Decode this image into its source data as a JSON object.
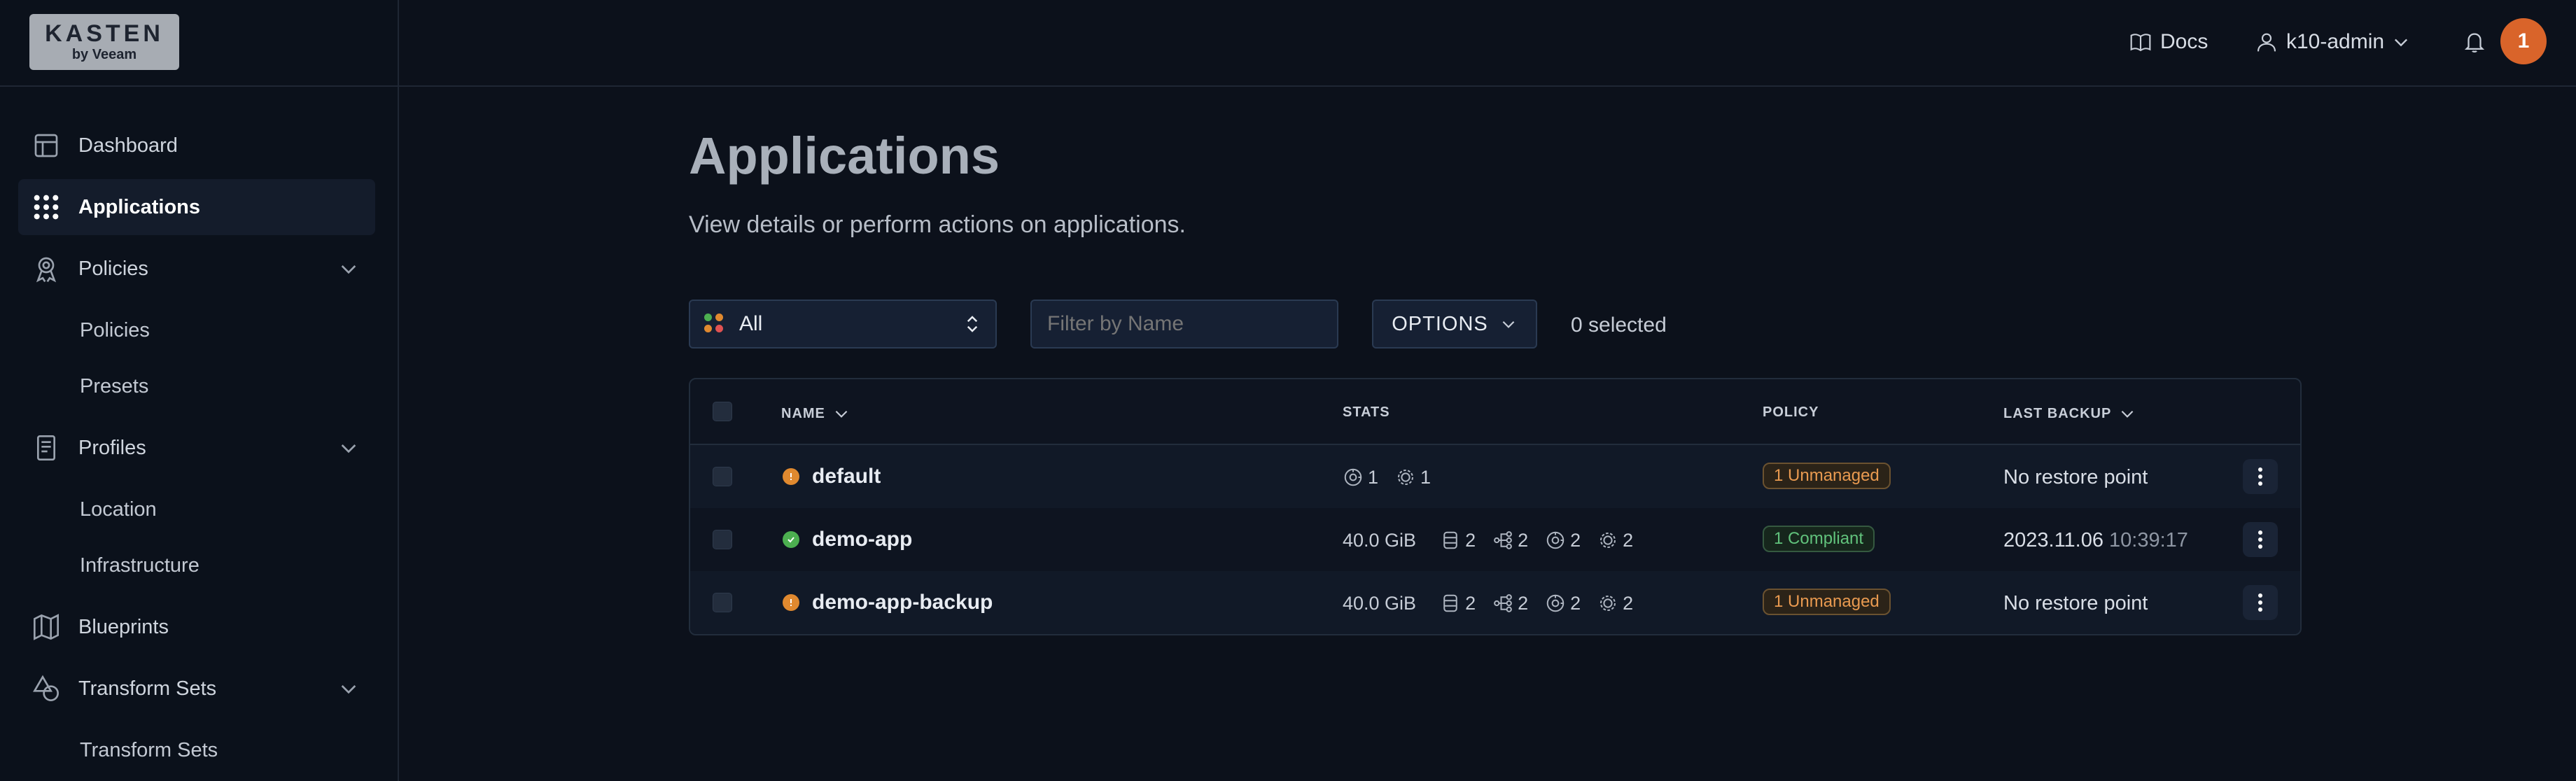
{
  "brand": {
    "logo_line1": "KASTEN",
    "logo_line2": "by Veeam"
  },
  "header": {
    "docs_label": "Docs",
    "user_label": "k10-admin",
    "notification_count": "1"
  },
  "sidebar": {
    "items": [
      {
        "label": "Dashboard",
        "icon": "layout-icon"
      },
      {
        "label": "Applications",
        "icon": "grid-dots-icon",
        "active": true
      },
      {
        "label": "Policies",
        "icon": "award-icon",
        "children": [
          "Policies",
          "Presets"
        ]
      },
      {
        "label": "Profiles",
        "icon": "document-icon",
        "children": [
          "Location",
          "Infrastructure"
        ]
      },
      {
        "label": "Blueprints",
        "icon": "map-icon"
      },
      {
        "label": "Transform Sets",
        "icon": "shapes-icon",
        "children": [
          "Transform Sets"
        ]
      }
    ]
  },
  "main": {
    "title": "Applications",
    "subtitle": "View details or perform actions on applications.",
    "filter": {
      "selected": "All",
      "name_placeholder": "Filter by Name",
      "options_label": "OPTIONS",
      "selected_count": "0 selected"
    },
    "table": {
      "columns": {
        "name": "NAME",
        "stats": "STATS",
        "policy": "POLICY",
        "last_backup": "LAST BACKUP"
      },
      "rows": [
        {
          "name": "default",
          "status": "warning",
          "size": "",
          "volumes": "",
          "workloads": "",
          "restore_points": "1",
          "policies": "1",
          "policy": "1 Unmanaged",
          "last_backup": "No restore point",
          "last_backup_time": ""
        },
        {
          "name": "demo-app",
          "status": "ok",
          "size": "40.0 GiB",
          "volumes": "2",
          "workloads": "2",
          "restore_points": "2",
          "policies": "2",
          "policy": "1 Compliant",
          "last_backup": "2023.11.06",
          "last_backup_time": "10:39:17"
        },
        {
          "name": "demo-app-backup",
          "status": "warning",
          "size": "40.0 GiB",
          "volumes": "2",
          "workloads": "2",
          "restore_points": "2",
          "policies": "2",
          "policy": "1 Unmanaged",
          "last_backup": "No restore point",
          "last_backup_time": ""
        }
      ]
    }
  },
  "colors": {
    "accent": "#d9642a",
    "warning": "#e0892f",
    "ok": "#4caf50",
    "background": "#0c111b"
  }
}
